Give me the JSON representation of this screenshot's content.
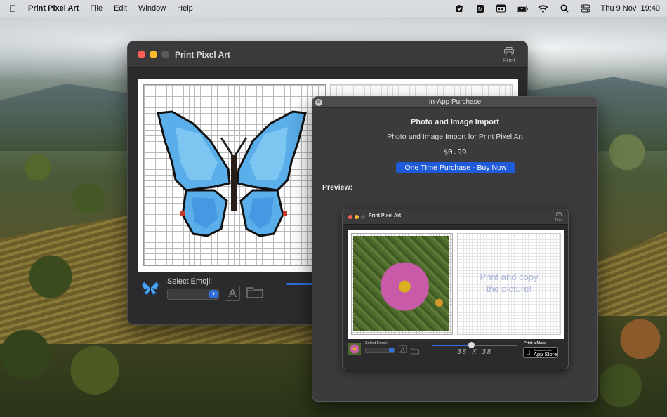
{
  "menubar": {
    "app_name": "Print Pixel Art",
    "menus": [
      "File",
      "Edit",
      "Window",
      "Help"
    ],
    "clock": "Thu 9 Nov  19:40"
  },
  "main_window": {
    "title": "Print Pixel Art",
    "print_label": "Print",
    "select_emoji_label": "Select Emoji:",
    "font_button_label": "A"
  },
  "iap_window": {
    "title": "In-App Purchase",
    "heading": "Photo and Image Import",
    "description": "Photo and Image Import for Print Pixel Art",
    "price": "$0.99",
    "buy_button": "One TIme Purchase - Buy Now",
    "preview_label": "Preview:"
  },
  "preview": {
    "title": "Print Pixel Art",
    "print_label": "Print",
    "overlay_text_line1": "Print and copy",
    "overlay_text_line2": "the picture!",
    "select_emoji_label": "Select Emoji:",
    "font_button_label": "A",
    "grid_size": "38 X 38",
    "slider_value": 0.46,
    "maze_label": "Print a Maze",
    "appstore_small": "Download on the",
    "appstore_big": "App Store"
  },
  "colors": {
    "accent": "#2e6fdc",
    "buy_button": "#1f5bd8",
    "traffic_close": "#ff5f57",
    "traffic_min": "#febc2e",
    "traffic_inactive": "#5a5a5c"
  },
  "icons": {
    "apple": "apple-logo-icon",
    "status": [
      "stash-icon",
      "shortcuts-icon",
      "calendar-icon",
      "battery-icon",
      "wifi-icon",
      "search-icon",
      "control-center-icon"
    ]
  }
}
